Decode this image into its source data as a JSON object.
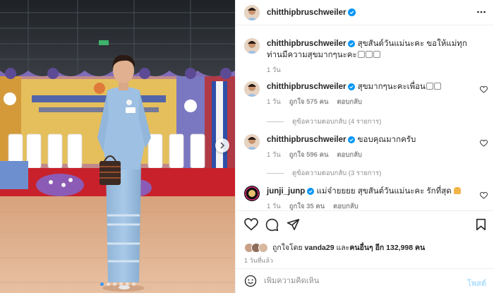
{
  "post": {
    "author": "chitthipbruschweiler"
  },
  "comments": [
    {
      "username": "chitthipbruschweiler",
      "text": "สุขสันต์วันแม่นะคะ ขอให้แม่ทุกท่านมีความสุขมากๆนะคะ",
      "time": "1 วัน"
    },
    {
      "username": "chitthipbruschweiler",
      "text": "สุขมากๆนะคะเพื่อน",
      "time": "1 วัน",
      "likes": "ถูกใจ 575 คน",
      "reply": "ตอบกลับ",
      "view_replies": "ดูข้อความตอบกลับ (4 รายการ)"
    },
    {
      "username": "chitthipbruschweiler",
      "text": "ขอบคุณมากครับ",
      "time": "1 วัน",
      "likes": "ถูกใจ 596 คน",
      "reply": "ตอบกลับ",
      "view_replies": "ดูข้อความตอบกลับ (3 รายการ)"
    },
    {
      "username": "junji_junp",
      "text": "แม่จ๋ายยยย สุขสันต์วันแม่นะคะ รักที่สุด",
      "time": "1 วัน",
      "likes": "ถูกใจ 35 คน",
      "reply": "ตอบกลับ"
    }
  ],
  "likes_summary": {
    "prefix": "ถูกใจโดย",
    "user": "vanda29",
    "middle": "และ",
    "others": "คนอื่นๆ อีก 132,998 คน"
  },
  "posted_time": "1 วันที่แล้ว",
  "composer": {
    "placeholder": "เพิ่มความคิดเห็น",
    "post_label": "โพสต์"
  },
  "icons": [
    "verified-icon",
    "more-icon",
    "heart-icon",
    "comment-icon",
    "share-icon",
    "bookmark-icon",
    "emoji-icon",
    "chevron-right-icon"
  ],
  "colors": {
    "verified": "#0095f6",
    "link_disabled": "#b2dffc",
    "muted": "#8e8e8e",
    "dot_active": "#3897f0"
  },
  "media": {
    "slide_count": 6,
    "active_slide": 1
  }
}
